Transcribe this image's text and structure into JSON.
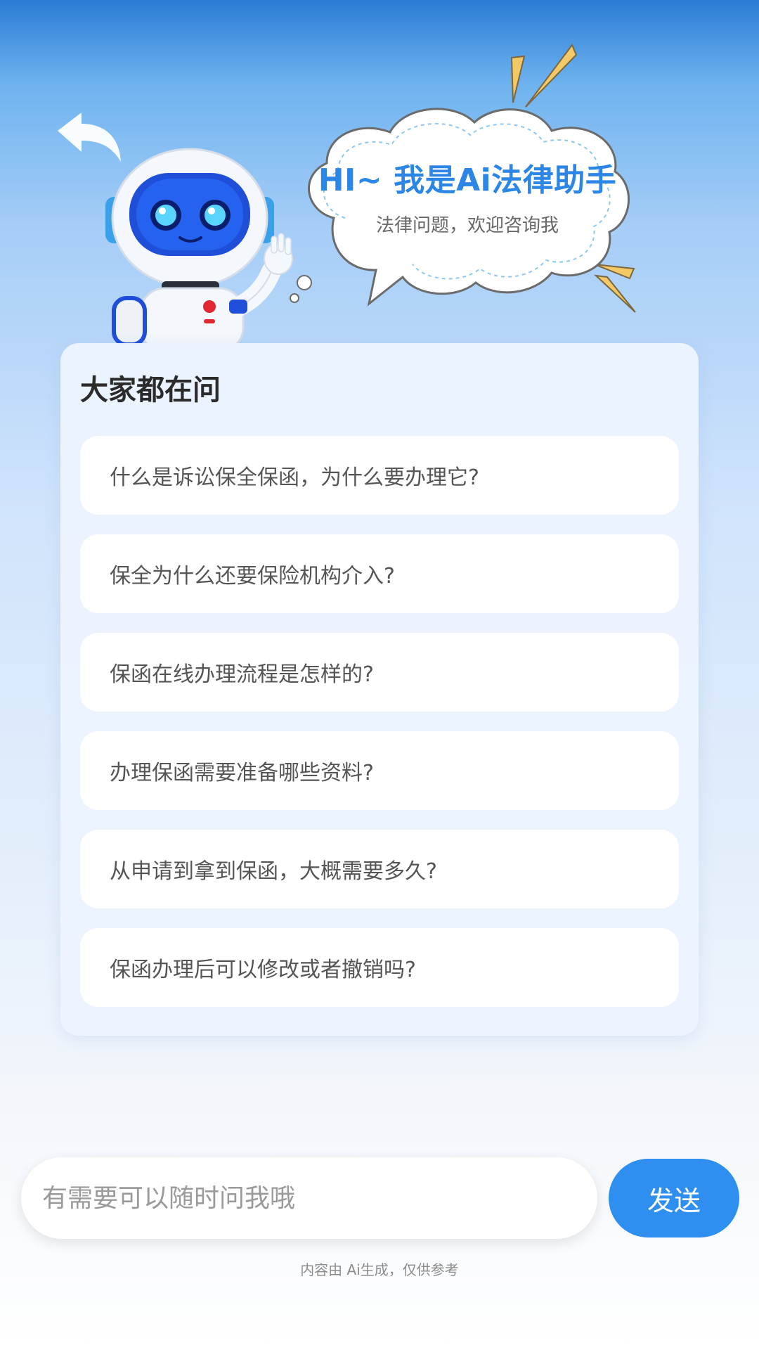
{
  "header": {
    "bubble_title": "HI~ 我是Ai法律助手",
    "bubble_subtitle": "法律问题，欢迎咨询我"
  },
  "questions": {
    "title": "大家都在问",
    "items": [
      "什么是诉讼保全保函，为什么要办理它?",
      "保全为什么还要保险机构介入?",
      "保函在线办理流程是怎样的?",
      "办理保函需要准备哪些资料?",
      "从申请到拿到保函，大概需要多久?",
      "保函办理后可以修改或者撤销吗?"
    ]
  },
  "composer": {
    "placeholder": "有需要可以随时问我哦",
    "value": "",
    "send_label": "发送"
  },
  "footer": {
    "disclaimer": "内容由 Ai生成，仅供参考"
  },
  "icons": {
    "back": "back-arrow-icon",
    "mascot": "robot-mascot-icon"
  },
  "colors": {
    "accent": "#2f8ff0",
    "title_blue": "#2c86e6",
    "deco_yellow": "#f3c867"
  }
}
